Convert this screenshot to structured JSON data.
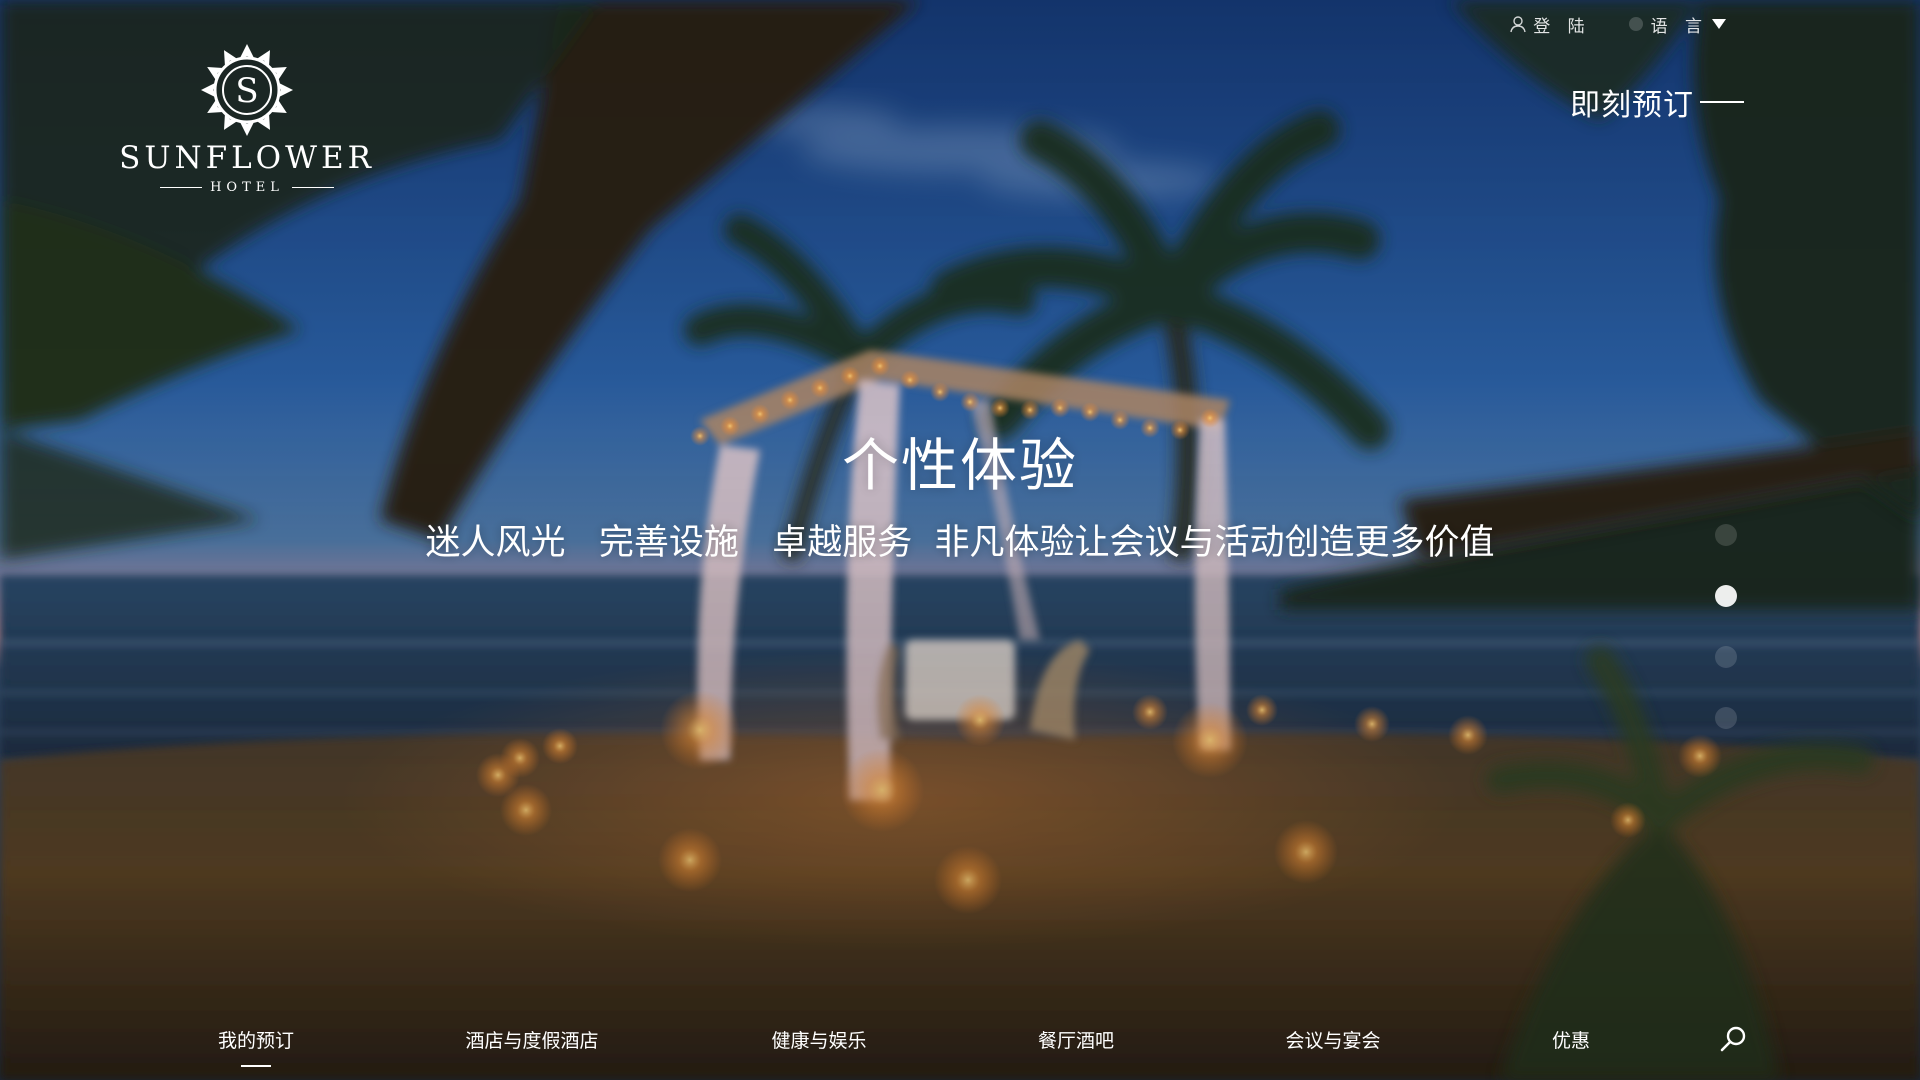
{
  "logo": {
    "emblem_letter": "S",
    "name": "SUNFLOWER",
    "sub": "HOTEL"
  },
  "header": {
    "login_label": "登 陆",
    "language_label": "语 言",
    "book_now_label": "即刻预订"
  },
  "hero": {
    "title": "个性体验",
    "subtitle": "迷人风光   完善设施   卓越服务  非凡体验让会议与活动创造更多价值"
  },
  "slider": {
    "slide_count": 4,
    "active_index": 1
  },
  "nav": {
    "items": [
      {
        "label": "我的预订",
        "active": true
      },
      {
        "label": "酒店与度假酒店",
        "active": false
      },
      {
        "label": "健康与娱乐",
        "active": false
      },
      {
        "label": "餐厅酒吧",
        "active": false
      },
      {
        "label": "会议与宴会",
        "active": false
      },
      {
        "label": "优惠",
        "active": false
      }
    ]
  },
  "icons": {
    "login": "user-icon",
    "language": "globe-icon",
    "search": "search-icon",
    "dropdown": "caret-down-icon"
  },
  "colors": {
    "text": "#ffffff",
    "sky_top": "#1f4f92",
    "horizon": "#c98d9a",
    "sand": "#5a4326",
    "candle": "#ffb34d"
  }
}
